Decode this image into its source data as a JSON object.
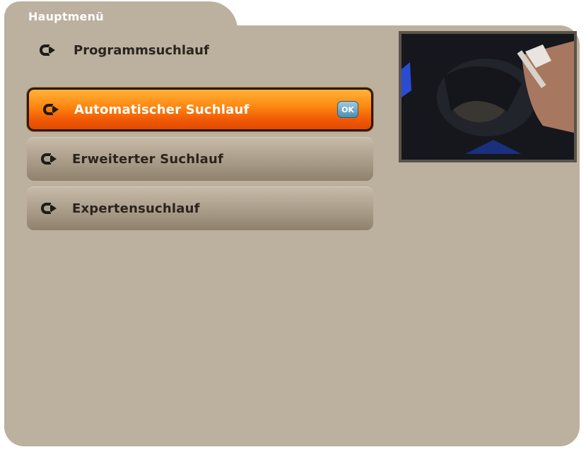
{
  "header": {
    "breadcrumb": "Hauptmenü",
    "submenu_title": "Programmsuchlauf"
  },
  "menu": {
    "items": [
      {
        "label": "Automatischer Suchlauf",
        "selected": true,
        "badge": "OK"
      },
      {
        "label": "Erweiterter Suchlauf",
        "selected": false
      },
      {
        "label": "Expertensuchlauf",
        "selected": false
      }
    ]
  },
  "colors": {
    "panel": "#bcb09f",
    "selected": "#ff8a12",
    "item": "#a99c89"
  },
  "icons": {
    "menu_arrow": "arrow-icon",
    "ok": "ok-badge-icon"
  }
}
